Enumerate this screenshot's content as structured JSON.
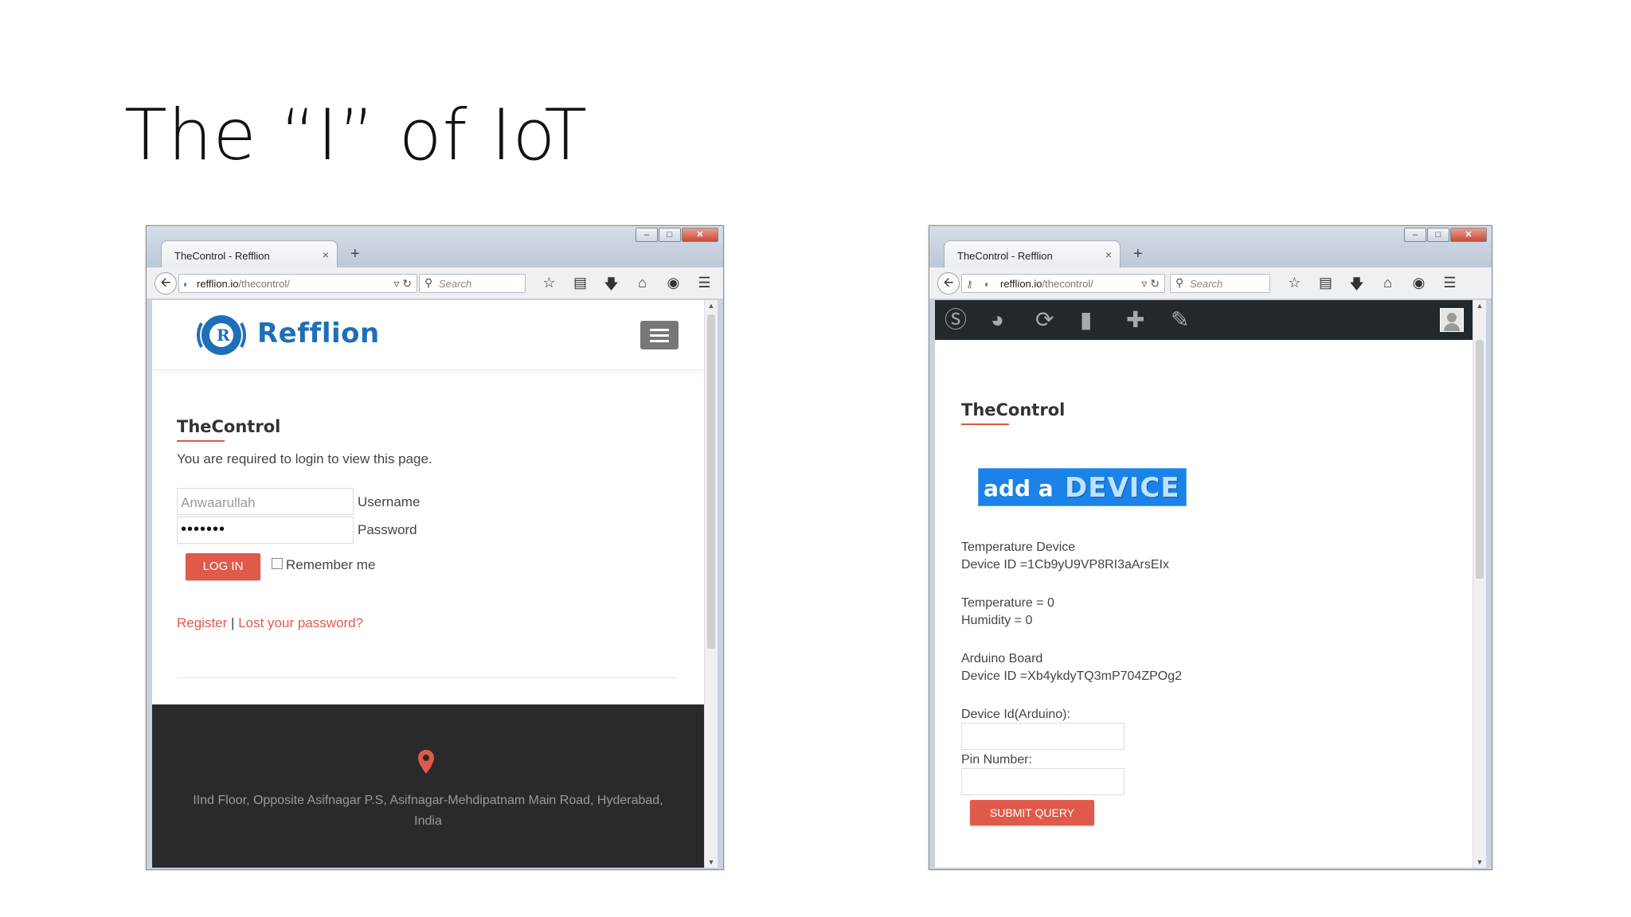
{
  "slide": {
    "title": "The “I” of IoT"
  },
  "left_window": {
    "tab_title": "TheControl - Refflion",
    "tab_close": "×",
    "new_tab": "+",
    "url_host": "refflion.io",
    "url_path": "/thecontrol/",
    "search_placeholder": "Search",
    "logo_text": "Refflion",
    "page_heading": "TheControl",
    "login_message": "You are required to login to view this page.",
    "username_value": "Anwaarullah",
    "username_label": "Username",
    "password_value": "•••••••",
    "password_label": "Password",
    "login_button": "LOG IN",
    "remember_label": "Remember me",
    "register_link": "Register",
    "separator": "|",
    "lost_password_link": "Lost your password?",
    "footer_line1": "IInd Floor, Opposite Asifnagar P.S, Asifnagar-Mehdipatnam Main Road, Hyderabad,",
    "footer_line2": "India"
  },
  "right_window": {
    "tab_title": "TheControl - Refflion",
    "tab_close": "×",
    "new_tab": "+",
    "url_host": "refflion.io",
    "url_path": "/thecontrol/",
    "search_placeholder": "Search",
    "page_heading": "TheControl",
    "banner_word1": "add a",
    "banner_word2": "DEVICE",
    "device1_name": "Temperature Device",
    "device1_id": "Device ID =1Cb9yU9VP8RI3aArsEIx",
    "temperature": "Temperature = 0",
    "humidity": "Humidity = 0",
    "device2_name": "Arduino Board",
    "device2_id": "Device ID =Xb4ykdyTQ3mP704ZPOg2",
    "device_id_label": "Device Id(Arduino):",
    "pin_label": "Pin Number:",
    "submit_button": "SUBMIT QUERY"
  },
  "colors": {
    "accent": "#e05a4b",
    "brand": "#1e6fb8",
    "wp_bar": "#23282d",
    "footer": "#2a2a2c"
  },
  "icons": [
    "back-arrow-icon",
    "globe-icon",
    "reload-icon",
    "search-icon",
    "star-icon",
    "clipboard-icon",
    "download-icon",
    "home-icon",
    "chat-icon",
    "menu-icon",
    "wordpress-icon",
    "dashboard-icon",
    "update-icon",
    "comment-icon",
    "plus-icon",
    "edit-icon",
    "avatar-icon",
    "location-pin-icon",
    "key-icon"
  ]
}
